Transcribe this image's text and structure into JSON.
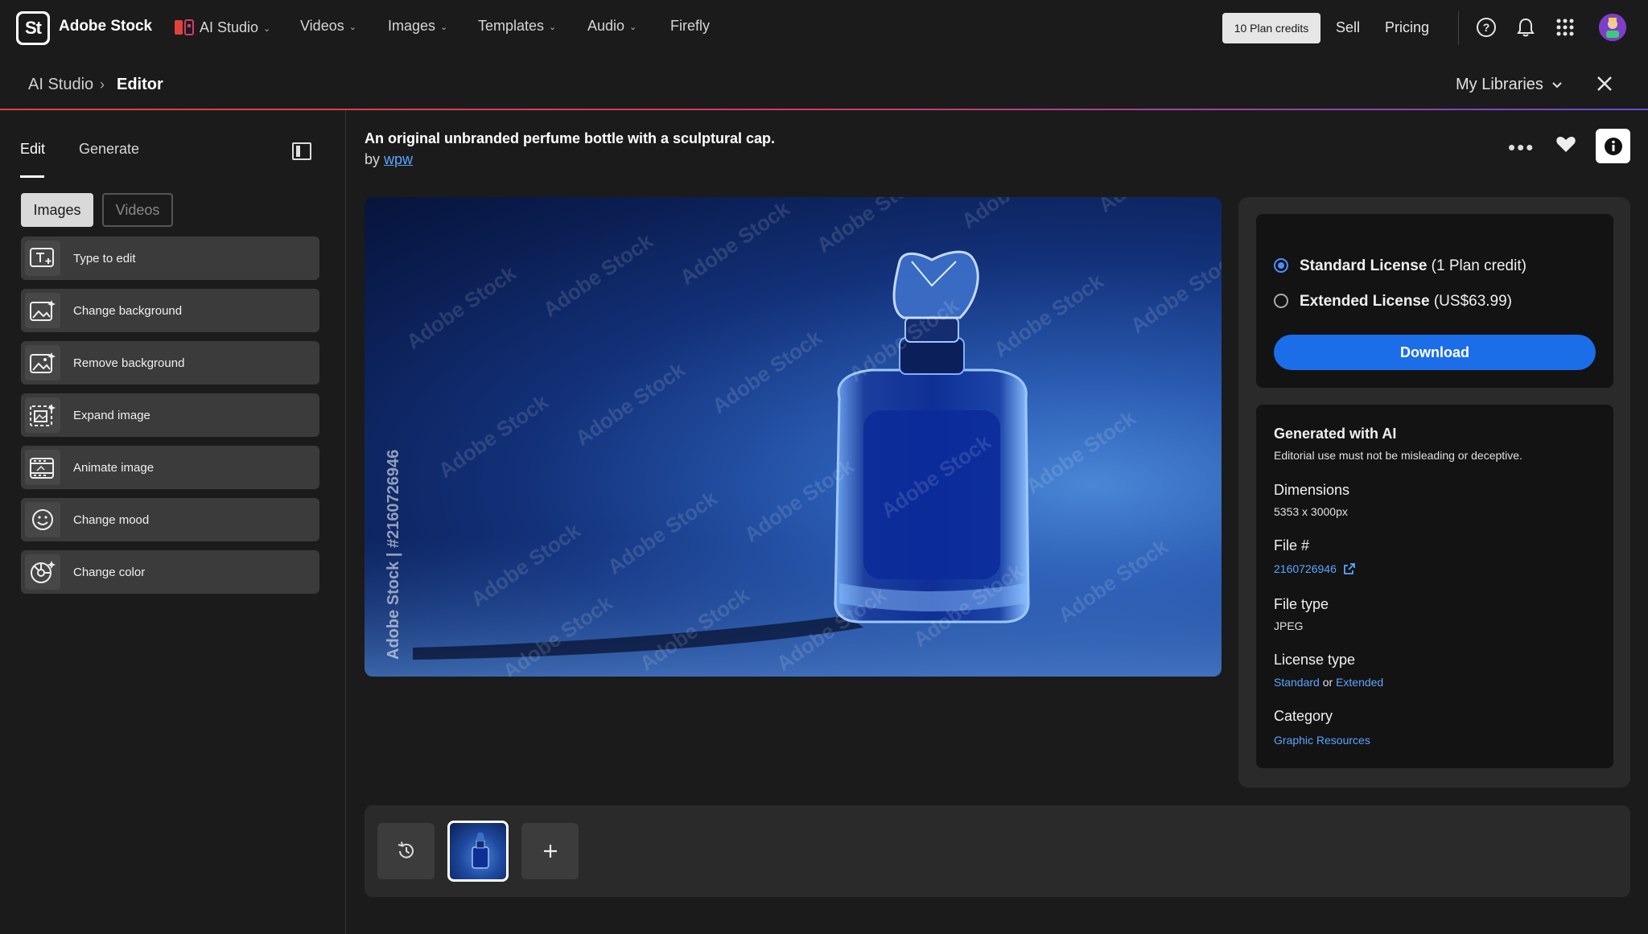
{
  "header": {
    "brand": "Adobe Stock",
    "logo_text": "St",
    "nav": [
      {
        "label": "AI Studio"
      },
      {
        "label": "Videos"
      },
      {
        "label": "Images"
      },
      {
        "label": "Templates"
      },
      {
        "label": "Audio"
      },
      {
        "label": "Firefly"
      }
    ],
    "credits": "10 Plan credits",
    "sell": "Sell",
    "pricing": "Pricing"
  },
  "breadcrumb": {
    "parent": "AI Studio",
    "current": "Editor",
    "libraries": "My Libraries"
  },
  "left": {
    "tabs": {
      "edit": "Edit",
      "generate": "Generate"
    },
    "segments": {
      "images": "Images",
      "videos": "Videos"
    },
    "tools": [
      {
        "label": "Type to edit"
      },
      {
        "label": "Change background"
      },
      {
        "label": "Remove background"
      },
      {
        "label": "Expand image"
      },
      {
        "label": "Animate image"
      },
      {
        "label": "Change mood"
      },
      {
        "label": "Change color"
      }
    ]
  },
  "asset": {
    "title": "An original unbranded perfume bottle with a sculptural cap.",
    "by": "by",
    "author": "wpw",
    "watermark": "Adobe Stock | #2160726946",
    "watermark_tile": "Adobe Stock"
  },
  "license": {
    "standard_name": "Standard License",
    "standard_price": "(1 Plan credit)",
    "extended_name": "Extended License",
    "extended_price": "(US$63.99)",
    "download": "Download"
  },
  "meta": {
    "ai_title": "Generated with AI",
    "ai_note": "Editorial use must not be misleading or deceptive.",
    "dimensions_label": "Dimensions",
    "dimensions_value": "5353 x 3000px",
    "file_label": "File #",
    "file_value": "2160726946",
    "filetype_label": "File type",
    "filetype_value": "JPEG",
    "licensetype_label": "License type",
    "lic_standard": "Standard",
    "lic_or": "or",
    "lic_extended": "Extended",
    "category_label": "Category",
    "category_value": "Graphic Resources"
  },
  "colors": {
    "accent": "#1b6de8",
    "link": "#5aa6ff",
    "background": "#1b1b1b"
  }
}
